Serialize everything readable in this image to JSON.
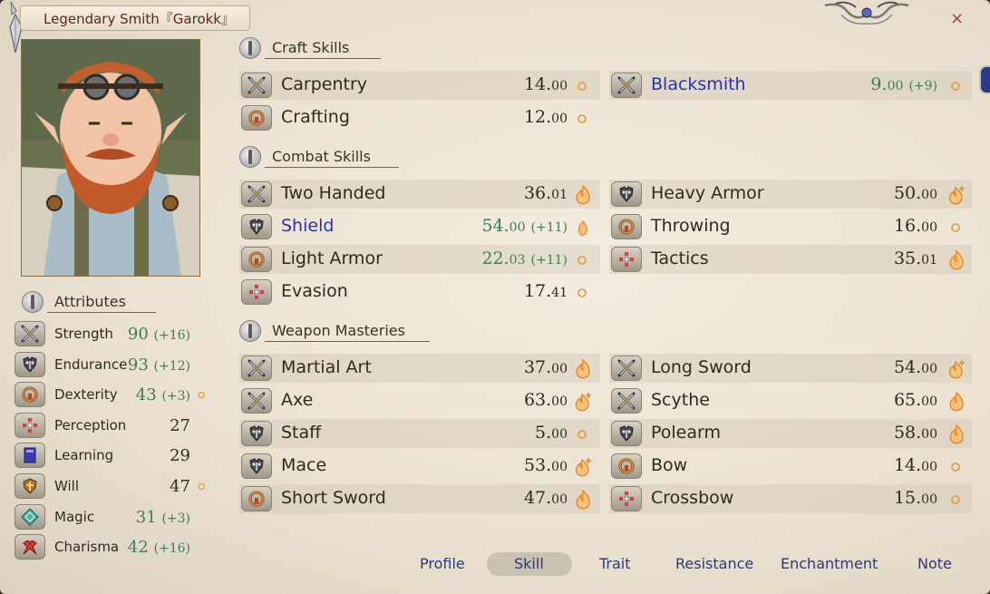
{
  "window": {
    "title": "Legendary Smith『Garokk』",
    "close_glyph": "×"
  },
  "sections": {
    "craft": "Craft Skills",
    "combat": "Combat Skills",
    "weapon": "Weapon Masteries",
    "attributes": "Attributes"
  },
  "craft_skills": [
    {
      "name": "Carpentry",
      "value": "14.",
      "decimal": "00",
      "bonus": "",
      "icon": "crossed-swords-icon",
      "potential": "small-dot",
      "blue": false
    },
    {
      "name": "Blacksmith",
      "value": "9.",
      "decimal": "00",
      "bonus": "(+9)",
      "icon": "crossed-swords-icon",
      "potential": "small-dot",
      "blue": true
    },
    {
      "name": "Crafting",
      "value": "12.",
      "decimal": "00",
      "bonus": "",
      "icon": "ring-icon",
      "potential": "small-dot",
      "blue": false
    }
  ],
  "combat_skills": [
    {
      "name": "Two Handed",
      "value": "36.",
      "decimal": "01",
      "bonus": "",
      "icon": "crossed-swords-icon",
      "potential": "flame",
      "blue": false
    },
    {
      "name": "Heavy Armor",
      "value": "50.",
      "decimal": "00",
      "bonus": "",
      "icon": "armor-icon",
      "potential": "flame-plus",
      "blue": false
    },
    {
      "name": "Shield",
      "value": "54.",
      "decimal": "00",
      "bonus": "(+11)",
      "icon": "armor-icon",
      "potential": "small-flame",
      "blue": true
    },
    {
      "name": "Throwing",
      "value": "16.",
      "decimal": "00",
      "bonus": "",
      "icon": "ring-icon",
      "potential": "small-dot",
      "blue": false
    },
    {
      "name": "Light Armor",
      "value": "22.",
      "decimal": "03",
      "bonus": "(+11)",
      "icon": "ring-icon",
      "potential": "small-dot",
      "blue": false
    },
    {
      "name": "Tactics",
      "value": "35.",
      "decimal": "01",
      "bonus": "",
      "icon": "cross-dots-icon",
      "potential": "flame",
      "blue": false
    },
    {
      "name": "Evasion",
      "value": "17.",
      "decimal": "41",
      "bonus": "",
      "icon": "cross-dots-icon",
      "potential": "small-dot",
      "blue": false
    }
  ],
  "weapon_masteries": [
    {
      "name": "Martial Art",
      "value": "37.",
      "decimal": "00",
      "bonus": "",
      "icon": "crossed-swords-icon",
      "potential": "flame"
    },
    {
      "name": "Long Sword",
      "value": "54.",
      "decimal": "00",
      "bonus": "",
      "icon": "crossed-swords-icon",
      "potential": "flame-plus"
    },
    {
      "name": "Axe",
      "value": "63.",
      "decimal": "00",
      "bonus": "",
      "icon": "crossed-swords-icon",
      "potential": "flame-plus"
    },
    {
      "name": "Scythe",
      "value": "65.",
      "decimal": "00",
      "bonus": "",
      "icon": "crossed-swords-icon",
      "potential": "flame"
    },
    {
      "name": "Staff",
      "value": "5.",
      "decimal": "00",
      "bonus": "",
      "icon": "armor-icon",
      "potential": "small-dot"
    },
    {
      "name": "Polearm",
      "value": "58.",
      "decimal": "00",
      "bonus": "",
      "icon": "armor-icon",
      "potential": "flame"
    },
    {
      "name": "Mace",
      "value": "53.",
      "decimal": "00",
      "bonus": "",
      "icon": "armor-icon",
      "potential": "flame-plus"
    },
    {
      "name": "Bow",
      "value": "14.",
      "decimal": "00",
      "bonus": "",
      "icon": "ring-icon",
      "potential": "small-dot"
    },
    {
      "name": "Short Sword",
      "value": "47.",
      "decimal": "00",
      "bonus": "",
      "icon": "ring-icon",
      "potential": "flame"
    },
    {
      "name": "Crossbow",
      "value": "15.",
      "decimal": "00",
      "bonus": "",
      "icon": "cross-dots-icon",
      "potential": "small-dot"
    }
  ],
  "attributes": [
    {
      "name": "Strength",
      "value": "90",
      "bonus": "(+16)",
      "icon": "crossed-swords-icon",
      "potential": ""
    },
    {
      "name": "Endurance",
      "value": "93",
      "bonus": "(+12)",
      "icon": "armor-icon",
      "potential": ""
    },
    {
      "name": "Dexterity",
      "value": "43",
      "bonus": "(+3)",
      "icon": "ring-icon",
      "potential": "small-dot"
    },
    {
      "name": "Perception",
      "value": "27",
      "bonus": "",
      "icon": "cross-dots-icon",
      "potential": ""
    },
    {
      "name": "Learning",
      "value": "29",
      "bonus": "",
      "icon": "book-icon",
      "potential": ""
    },
    {
      "name": "Will",
      "value": "47",
      "bonus": "",
      "icon": "shield-icon",
      "potential": "small-dot"
    },
    {
      "name": "Magic",
      "value": "31",
      "bonus": "(+3)",
      "icon": "diamond-icon",
      "potential": ""
    },
    {
      "name": "Charisma",
      "value": "42",
      "bonus": "(+16)",
      "icon": "ribbon-icon",
      "potential": ""
    }
  ],
  "tabs": [
    "Profile",
    "Skill",
    "Trait",
    "Resistance",
    "Enchantment",
    "Note"
  ],
  "active_tab": "Skill",
  "colors": {
    "title": "#5a2a1a",
    "skill_text": "#2e2a22",
    "highlight_blue": "#2b32b0",
    "bonus_green": "#3e7a5c",
    "tab_text": "#2c3a70",
    "flame": "#f0a040"
  }
}
